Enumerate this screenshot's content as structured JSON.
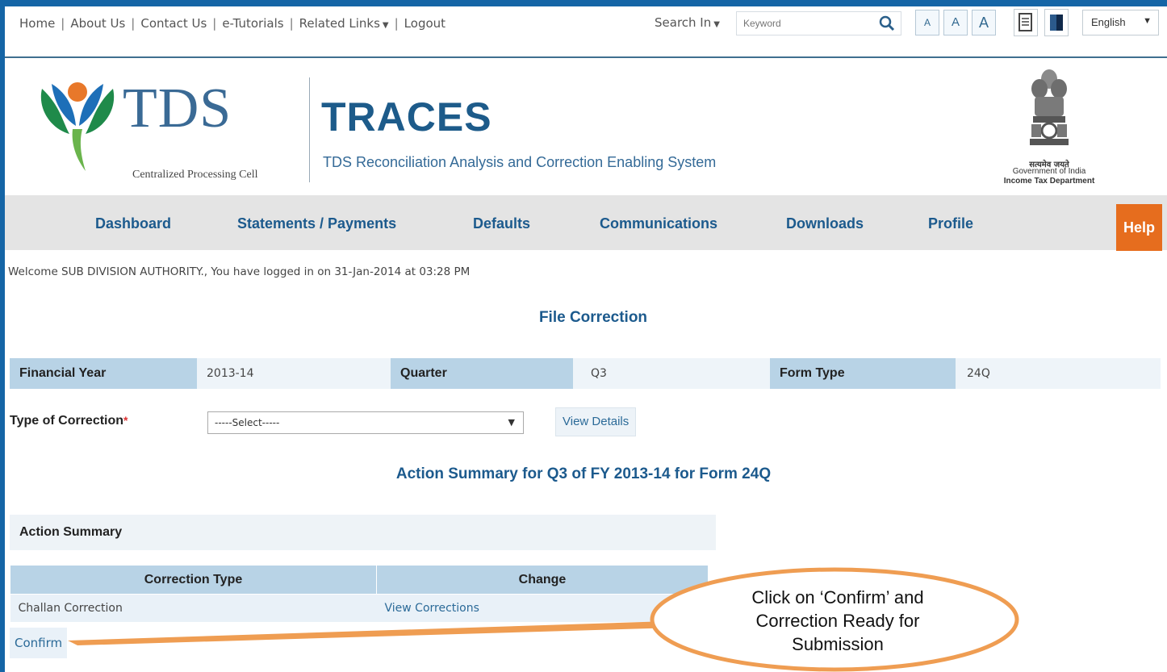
{
  "top_links": {
    "home": "Home",
    "about": "About Us",
    "contact": "Contact Us",
    "tutorials": "e-Tutorials",
    "related": "Related Links",
    "logout": "Logout"
  },
  "search": {
    "search_in_label": "Search In",
    "placeholder": "Keyword",
    "icon": "search-icon"
  },
  "font_size_controls": [
    "A",
    "A",
    "A"
  ],
  "language": {
    "selected": "English"
  },
  "header": {
    "logo_text": "TDS",
    "logo_subtitle": "Centralized Processing Cell",
    "app_title": "TRACES",
    "app_subtitle": "TDS Reconciliation Analysis and Correction Enabling System",
    "emblem_hindi": "सत्यमेव जयते",
    "emblem_goi": "Government of India",
    "emblem_itd": "Income Tax Department"
  },
  "nav": {
    "items": [
      "Dashboard",
      "Statements / Payments",
      "Defaults",
      "Communications",
      "Downloads",
      "Profile"
    ],
    "help": "Help"
  },
  "welcome_text": "Welcome SUB DIVISION AUTHORITY., You have logged in on 31-Jan-2014 at 03:28 PM",
  "page_title": "File Correction",
  "info": {
    "fy_label": "Financial Year",
    "fy_value": "2013-14",
    "quarter_label": "Quarter",
    "quarter_value": "Q3",
    "form_label": "Form Type",
    "form_value": "24Q"
  },
  "correction": {
    "label": "Type of Correction",
    "required_mark": "*",
    "select_value": "-----Select-----",
    "view_details": "View Details"
  },
  "summary_title": "Action Summary for Q3 of FY 2013-14 for Form 24Q",
  "action_summary_label": "Action Summary",
  "table": {
    "headers": [
      "Correction Type",
      "Change"
    ],
    "rows": [
      {
        "type": "Challan Correction",
        "change": "View Corrections"
      }
    ]
  },
  "confirm_label": "Confirm",
  "callout": {
    "line1": "Click on ‘Confirm’  and",
    "line2": "Correction Ready for",
    "line3": "Submission",
    "color": "#ef9d52"
  },
  "colors": {
    "frame": "#1565a6",
    "nav_text": "#1c5a8d",
    "help_bg": "#e66d1e",
    "label_bg": "#b8d3e6"
  }
}
